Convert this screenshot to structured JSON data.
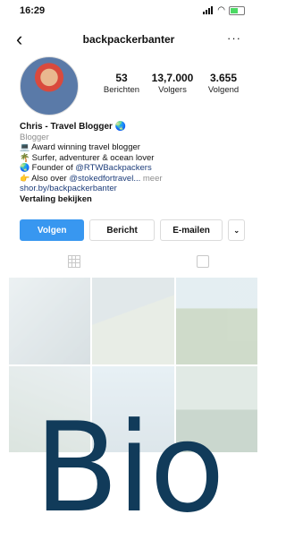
{
  "status_bar": {
    "time": "16:29"
  },
  "header": {
    "username": "backpackerbanter",
    "back_glyph": "‹",
    "more_glyph": "···"
  },
  "profile": {
    "stats": [
      {
        "number": "53",
        "label": "Berichten"
      },
      {
        "number": "13,7.000",
        "label": "Volgers"
      },
      {
        "number": "3.655",
        "label": "Volgend"
      }
    ]
  },
  "bio": {
    "name": "Chris - Travel Blogger 🌏",
    "category": "Blogger",
    "lines": [
      {
        "icon": "laptop-icon",
        "glyph": "💻",
        "text": "Award winning travel blogger"
      },
      {
        "icon": "palm-tree-icon",
        "glyph": "🌴",
        "text": "Surfer, adventurer & ocean lover"
      },
      {
        "icon": "globe-icon",
        "glyph": "🌏",
        "text": "Founder of ",
        "link": "@RTWBackpackers"
      },
      {
        "icon": "point-right-icon",
        "glyph": "👉",
        "text": "Also over ",
        "link": "@stokedfortravel...",
        "more": " meer"
      }
    ],
    "website": "shor.by/backpackerbanter",
    "translation": "Vertaling bekijken"
  },
  "actions": {
    "follow": "Volgen",
    "message": "Bericht",
    "email": "E-mailen",
    "dropdown_glyph": "⌄"
  },
  "overlay": {
    "text": "Bio"
  },
  "colors": {
    "primary_button": "#3897f0",
    "link": "#1d3d7a",
    "overlay_text": "#113b5a"
  }
}
